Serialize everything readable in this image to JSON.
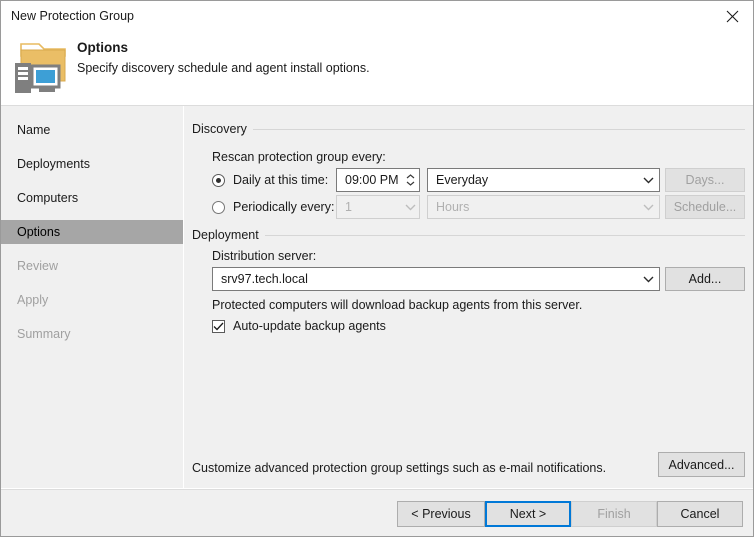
{
  "window": {
    "title": "New Protection Group",
    "close_icon": "close-icon"
  },
  "header": {
    "title": "Options",
    "subtitle": "Specify discovery schedule and agent install options.",
    "icon": "protection-group-folder-icon"
  },
  "sidebar": {
    "items": [
      {
        "label": "Name",
        "state": "enabled"
      },
      {
        "label": "Deployments",
        "state": "enabled"
      },
      {
        "label": "Computers",
        "state": "enabled"
      },
      {
        "label": "Options",
        "state": "active"
      },
      {
        "label": "Review",
        "state": "disabled"
      },
      {
        "label": "Apply",
        "state": "disabled"
      },
      {
        "label": "Summary",
        "state": "disabled"
      }
    ]
  },
  "discovery": {
    "group_label": "Discovery",
    "rescan_label": "Rescan protection group every:",
    "daily": {
      "radio_label": "Daily at this time:",
      "selected": true,
      "time_value": "09:00 PM",
      "day_value": "Everyday",
      "days_button": "Days...",
      "days_button_enabled": false
    },
    "periodic": {
      "radio_label": "Periodically every:",
      "selected": false,
      "interval_value": "1",
      "unit_value": "Hours",
      "schedule_button": "Schedule...",
      "schedule_button_enabled": false
    }
  },
  "deployment": {
    "group_label": "Deployment",
    "server_label": "Distribution server:",
    "server_value": "srv97.tech.local",
    "add_button": "Add...",
    "hint": "Protected computers will download backup agents from this server.",
    "auto_update_label": "Auto-update backup agents",
    "auto_update_checked": true
  },
  "advanced": {
    "hint": "Customize advanced protection group settings such as e-mail notifications.",
    "button": "Advanced..."
  },
  "footer": {
    "previous": "< Previous",
    "next": "Next >",
    "finish": "Finish",
    "cancel": "Cancel",
    "finish_enabled": false,
    "next_is_default": true
  },
  "colors": {
    "accent": "#0078d7",
    "panel": "#f0f0f0",
    "active_nav": "#a6a6a6",
    "folder": "#e8bb61",
    "monitor": "#3d9fd6",
    "chassis": "#7f7f7f"
  }
}
